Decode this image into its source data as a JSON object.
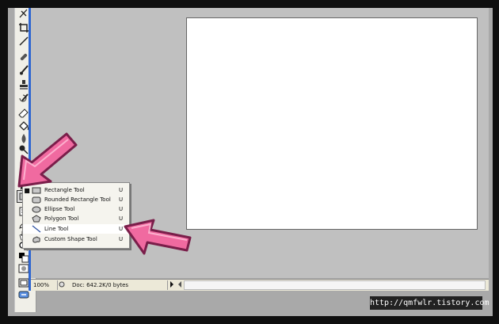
{
  "statusbar": {
    "zoom": "100%",
    "doc_info": "Doc: 642.2K/0 bytes"
  },
  "flyout": {
    "items": [
      {
        "label": "Rectangle Tool",
        "shortcut": "U",
        "icon": "rectangle-icon",
        "active": true
      },
      {
        "label": "Rounded Rectangle Tool",
        "shortcut": "U",
        "icon": "rounded-rectangle-icon",
        "active": false
      },
      {
        "label": "Ellipse Tool",
        "shortcut": "U",
        "icon": "ellipse-icon",
        "active": false
      },
      {
        "label": "Polygon Tool",
        "shortcut": "U",
        "icon": "polygon-icon",
        "active": false
      },
      {
        "label": "Line Tool",
        "shortcut": "U",
        "icon": "line-icon",
        "active": false
      },
      {
        "label": "Custom Shape Tool",
        "shortcut": "U",
        "icon": "custom-shape-icon",
        "active": false
      }
    ],
    "active_bullet": "■"
  },
  "watermark": "http://qmfwlr.tistory.com",
  "colors": {
    "arrow_fill": "#f06aa0",
    "arrow_outline": "#7a1e4a",
    "workspace": "#c0c0c0",
    "accent_blue": "#2f66d0"
  }
}
